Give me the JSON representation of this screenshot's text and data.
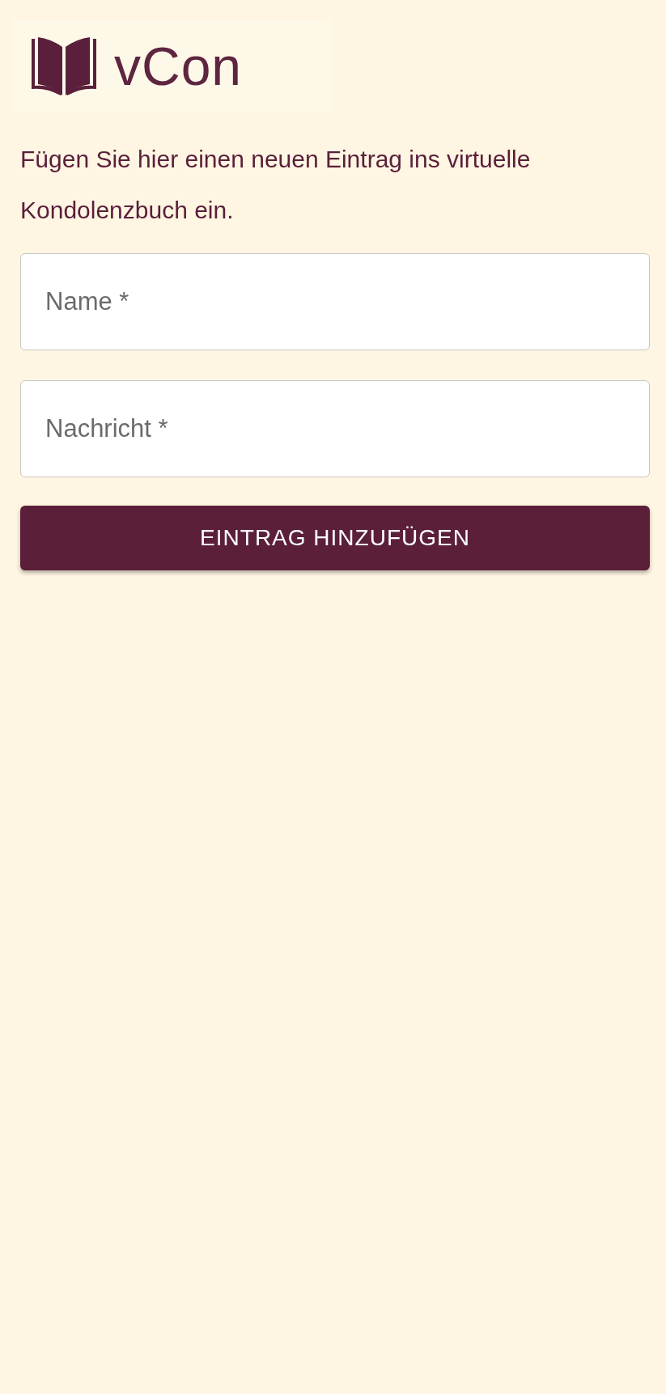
{
  "logo": {
    "text": "vCon"
  },
  "intro": "Fügen Sie hier einen neuen Eintrag ins virtuelle Kondolenzbuch ein.",
  "fields": [
    {
      "placeholder": "Name *"
    },
    {
      "placeholder": "Nachricht *"
    }
  ],
  "submit_button": "EINTRAG HINZUFÜGEN"
}
